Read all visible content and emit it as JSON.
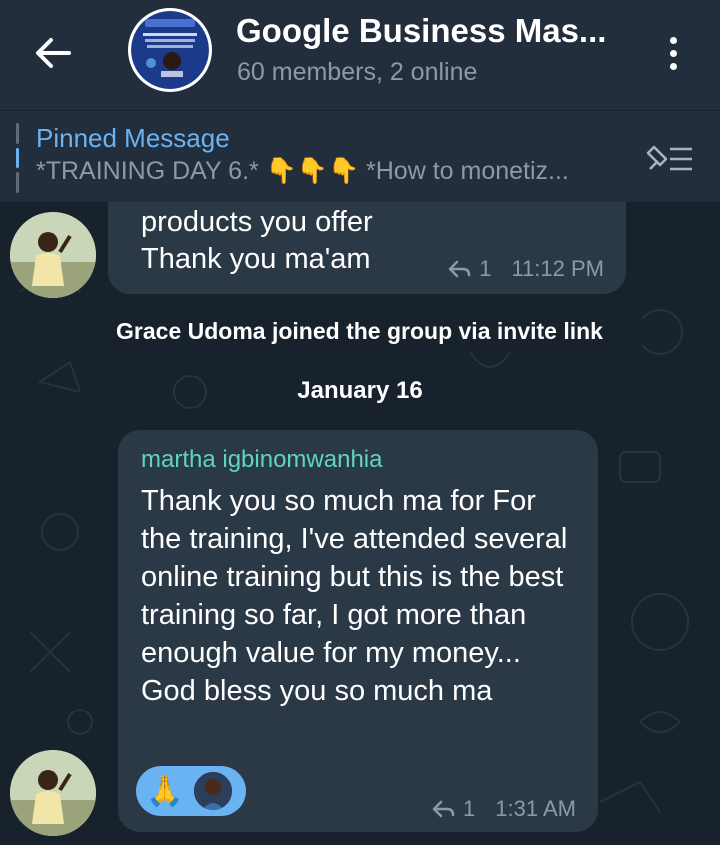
{
  "header": {
    "back_icon": "arrow-left-icon",
    "title": "Google Business Mas...",
    "subtitle": "60 members, 2 online",
    "menu_icon": "more-vertical-icon"
  },
  "pinned": {
    "label": "Pinned Message",
    "text": "*TRAINING DAY 6.* 👇👇👇 *How to monetiz...",
    "list_icon": "pinned-list-icon"
  },
  "messages": [
    {
      "text_lines": [
        "products you offer",
        "Thank you ma'am"
      ],
      "replies": "1",
      "time": "11:12 PM"
    },
    {
      "sender": "martha igbinomwanhia",
      "text": "Thank you so much ma for For the training, I've attended several online training but this is the best training so far, I got more than enough value for my money... God bless you so much ma",
      "reaction_emoji": "🙏",
      "replies": "1",
      "time": "1:31 AM"
    }
  ],
  "service_message": "Grace Udoma joined the group via invite link",
  "date_separator": "January 16",
  "colors": {
    "header_bg": "#232e3c",
    "chat_bg": "#18222d",
    "bubble_bg": "#2b3846",
    "accent": "#6ab3f3",
    "sender_name": "#5fd4c4",
    "muted": "#8b9aab"
  }
}
